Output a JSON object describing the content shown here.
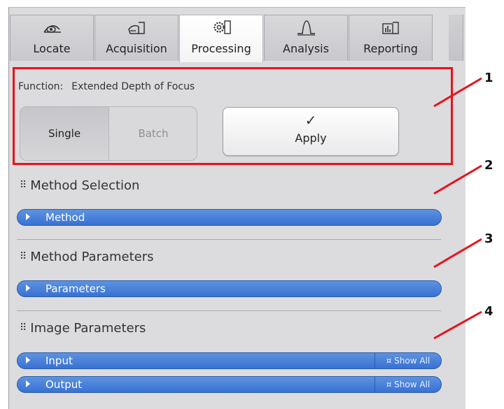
{
  "tabs": [
    {
      "label": "Locate",
      "icon": "locate-icon"
    },
    {
      "label": "Acquisition",
      "icon": "acquisition-icon"
    },
    {
      "label": "Processing",
      "icon": "gear-icon",
      "active": true
    },
    {
      "label": "Analysis",
      "icon": "analysis-icon"
    },
    {
      "label": "Reporting",
      "icon": "reporting-icon"
    }
  ],
  "function_row": {
    "label": "Function:",
    "value": "Extended Depth of Focus"
  },
  "mode_toggle": {
    "single": "Single",
    "batch": "Batch",
    "selected": "Single"
  },
  "apply_button": {
    "label": "Apply",
    "icon": "checkmark-icon"
  },
  "sections": {
    "method_selection": {
      "title": "Method Selection",
      "bar_label": "Method"
    },
    "method_parameters": {
      "title": "Method Parameters",
      "bar_label": "Parameters"
    },
    "image_parameters": {
      "title": "Image Parameters",
      "input_label": "Input",
      "output_label": "Output",
      "show_all": "¤ Show All"
    }
  },
  "callouts": [
    "1",
    "2",
    "3",
    "4"
  ],
  "colors": {
    "accent_blue": "#3b77d6",
    "highlight_red": "#e8131b",
    "panel_gray": "#dcdcdf"
  }
}
